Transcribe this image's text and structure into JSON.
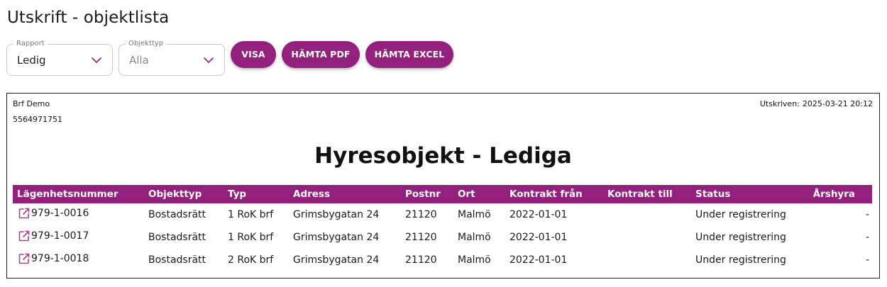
{
  "page": {
    "title": "Utskrift - objektlista"
  },
  "filters": {
    "rapport": {
      "label": "Rapport",
      "value": "Ledig",
      "icon": "chevron-down-icon"
    },
    "objekttyp": {
      "label": "Objekttyp",
      "value": "Alla",
      "icon": "chevron-down-icon"
    }
  },
  "buttons": {
    "visa": "VISA",
    "pdf": "HÄMTA PDF",
    "excel": "HÄMTA EXCEL"
  },
  "colors": {
    "accent": "#94207d",
    "icon": "#b13a92"
  },
  "report": {
    "org_name": "Brf Demo",
    "org_number": "5564971751",
    "printed_label": "Utskriven:",
    "printed_at": "2025-03-21 20:12",
    "title": "Hyresobjekt - Lediga",
    "columns": [
      "Lägenhetsnummer",
      "Objekttyp",
      "Typ",
      "Adress",
      "Postnr",
      "Ort",
      "Kontrakt från",
      "Kontrakt till",
      "Status",
      "Årshyra"
    ],
    "rows": [
      {
        "apartment": "979-1-0016",
        "object_type": "Bostadsrätt",
        "type": "1 RoK brf",
        "address": "Grimsbygatan 24",
        "postal_code": "21120",
        "city": "Malmö",
        "contract_from": "2022-01-01",
        "contract_to": "",
        "status": "Under registrering",
        "annual_rent": "-"
      },
      {
        "apartment": "979-1-0017",
        "object_type": "Bostadsrätt",
        "type": "1 RoK brf",
        "address": "Grimsbygatan 24",
        "postal_code": "21120",
        "city": "Malmö",
        "contract_from": "2022-01-01",
        "contract_to": "",
        "status": "Under registrering",
        "annual_rent": "-"
      },
      {
        "apartment": "979-1-0018",
        "object_type": "Bostadsrätt",
        "type": "2 RoK brf",
        "address": "Grimsbygatan 24",
        "postal_code": "21120",
        "city": "Malmö",
        "contract_from": "2022-01-01",
        "contract_to": "",
        "status": "Under registrering",
        "annual_rent": "-"
      }
    ],
    "row_icon": "external-link-icon"
  }
}
